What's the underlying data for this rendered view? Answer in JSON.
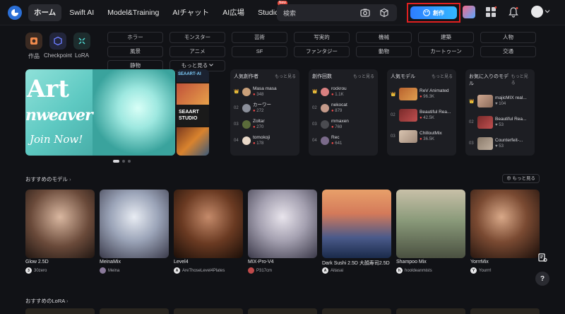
{
  "nav": {
    "items": [
      "ホーム",
      "Swift AI",
      "Model&Training",
      "AIチャット",
      "AI広場",
      "Studio"
    ],
    "studio_badge": "New",
    "search_placeholder": "検索",
    "create_label": "創作"
  },
  "categories": [
    "作品",
    "Checkpoint",
    "LoRA"
  ],
  "tags": [
    "ホラー",
    "モンスター",
    "芸術",
    "写実的",
    "機械",
    "建築",
    "人物",
    "風景",
    "アニメ",
    "SF",
    "ファンタジー",
    "動物",
    "カートゥーン",
    "交通",
    "静物",
    "もっと見る"
  ],
  "banner": {
    "title1": "Art",
    "title2": "nweaver",
    "cta": "Join Now!",
    "second_title1": "SEAART·AI",
    "second_title2": "SEAART STUDIO"
  },
  "rankings": [
    {
      "title": "人気創作者",
      "more": "もっと見る",
      "rows": [
        {
          "num": "",
          "name": "Masa masa",
          "stat": "348"
        },
        {
          "num": "02",
          "name": "カーワー",
          "stat": "272"
        },
        {
          "num": "03",
          "name": "Zoltar",
          "stat": "270"
        },
        {
          "num": "04",
          "name": "tomokoji",
          "stat": "178"
        }
      ]
    },
    {
      "title": "創作回数",
      "more": "もっと見る",
      "rows": [
        {
          "num": "",
          "name": "rockrou",
          "stat": "1.1K"
        },
        {
          "num": "02",
          "name": "nekocat",
          "stat": "879"
        },
        {
          "num": "03",
          "name": "mmaxen",
          "stat": "769"
        },
        {
          "num": "04",
          "name": "Rec",
          "stat": "641"
        }
      ]
    },
    {
      "title": "人気モデル",
      "more": "もっと見る",
      "rows": [
        {
          "num": "",
          "name": "ReV Animated",
          "stat": "96.3K"
        },
        {
          "num": "02",
          "name": "Beautiful Rea...",
          "stat": "42.5K"
        },
        {
          "num": "03",
          "name": "ChilloutMix",
          "stat": "36.5K"
        }
      ]
    },
    {
      "title": "お気に入りのモデル",
      "more": "もっと見る",
      "rows": [
        {
          "num": "",
          "name": "majicMIX real...",
          "stat": "104"
        },
        {
          "num": "02",
          "name": "Beautiful Rea...",
          "stat": "53"
        },
        {
          "num": "03",
          "name": "Counterfeit-...",
          "stat": "53"
        }
      ]
    }
  ],
  "recommended_models": {
    "title": "おすすめのモデル",
    "more": "もっと見る",
    "items": [
      {
        "title": "Glow 2.5D",
        "user": "30zero",
        "initial": "3"
      },
      {
        "title": "MeinaMix",
        "user": "Meina",
        "initial": ""
      },
      {
        "title": "Level4",
        "user": "AreThoseLevel4Plates",
        "initial": "A"
      },
      {
        "title": "MIX-Pro-V4",
        "user": "P317cm",
        "initial": ""
      },
      {
        "title": "Dark Sushi 2.5D 大顔寿司2.5D",
        "user": "Aitasai",
        "initial": "A"
      },
      {
        "title": "Shampoo Mix",
        "user": "hooldeanmists",
        "initial": "h"
      },
      {
        "title": "YorrrMix",
        "user": "Yourrrl",
        "initial": "Y"
      }
    ]
  },
  "recommended_lora": {
    "title": "おすすめのLoRA"
  },
  "help_label": "?"
}
